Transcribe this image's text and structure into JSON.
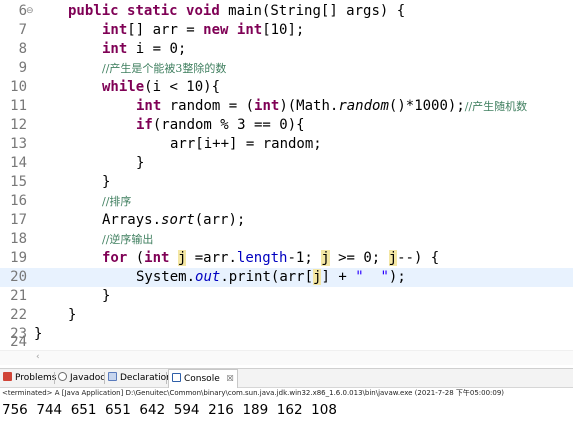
{
  "editor": {
    "fold_marker": "⊖",
    "lines": [
      {
        "n": "6"
      },
      {
        "n": "7"
      },
      {
        "n": "8"
      },
      {
        "n": "9"
      },
      {
        "n": "10"
      },
      {
        "n": "11"
      },
      {
        "n": "12"
      },
      {
        "n": "13"
      },
      {
        "n": "14"
      },
      {
        "n": "15"
      },
      {
        "n": "16"
      },
      {
        "n": "17"
      },
      {
        "n": "18"
      },
      {
        "n": "19"
      },
      {
        "n": "20"
      },
      {
        "n": "21"
      },
      {
        "n": "22"
      },
      {
        "n": "23"
      },
      {
        "n": "24"
      }
    ],
    "code": {
      "l6": [
        "public",
        " ",
        "static",
        " ",
        "void",
        " main(String[] args) {"
      ],
      "l7": [
        "int",
        "[] arr = ",
        "new",
        " ",
        "int",
        "[10];"
      ],
      "l8": [
        "int",
        " i = 0;"
      ],
      "l9": [
        "//产生是个能被3整除的数"
      ],
      "l10": [
        "while",
        "(i < 10){"
      ],
      "l11": [
        "int",
        " random = (",
        "int",
        ")(Math.",
        "random",
        "()*1000);",
        "//产生随机数"
      ],
      "l12": [
        "if",
        "(random % 3 == 0){"
      ],
      "l13": [
        "arr[i++] = random;"
      ],
      "l14": [
        "}"
      ],
      "l15": [
        "}"
      ],
      "l16": [
        "//排序"
      ],
      "l17": [
        "Arrays.",
        "sort",
        "(arr);"
      ],
      "l18": [
        "//逆序输出"
      ],
      "l19": [
        "for",
        " (",
        "int",
        " ",
        "j",
        " =arr.",
        "length",
        "-1; ",
        "j",
        " >= 0; ",
        "j",
        "--) {"
      ],
      "l20": [
        "System.",
        "out",
        ".print(arr[",
        "j",
        "] + ",
        "\"  \"",
        ");"
      ],
      "l21": [
        "}"
      ],
      "l22": [
        "}"
      ],
      "l23": [
        "}"
      ]
    }
  },
  "scrollbar": {
    "left_arrow": "‹"
  },
  "tabs": [
    {
      "label": "Problems",
      "icon": "problems-icon",
      "color": "#d04437"
    },
    {
      "label": "Javadoc",
      "icon": "javadoc-icon",
      "color": "#6a6a6a"
    },
    {
      "label": "Declaration",
      "icon": "declaration-icon",
      "color": "#5a7bbd"
    },
    {
      "label": "Console",
      "icon": "console-icon",
      "color": "#2f5fa8",
      "active": true,
      "close": "☒"
    }
  ],
  "console": {
    "status": "<terminated> A [Java Application] D:\\Genuitec\\Common\\binary\\com.sun.java.jdk.win32.x86_1.6.0.013\\bin\\javaw.exe (2021-7-28 下午05:00:09)",
    "output": "756  744  651  651  642  594  216  189  162  108"
  },
  "colors": {
    "keyword": "#7f0055",
    "comment": "#3f7f5f",
    "field": "#0000c0",
    "string": "#2a00ff",
    "current_line": "#e8f2fe",
    "occurrence": "#f4e7a4"
  }
}
